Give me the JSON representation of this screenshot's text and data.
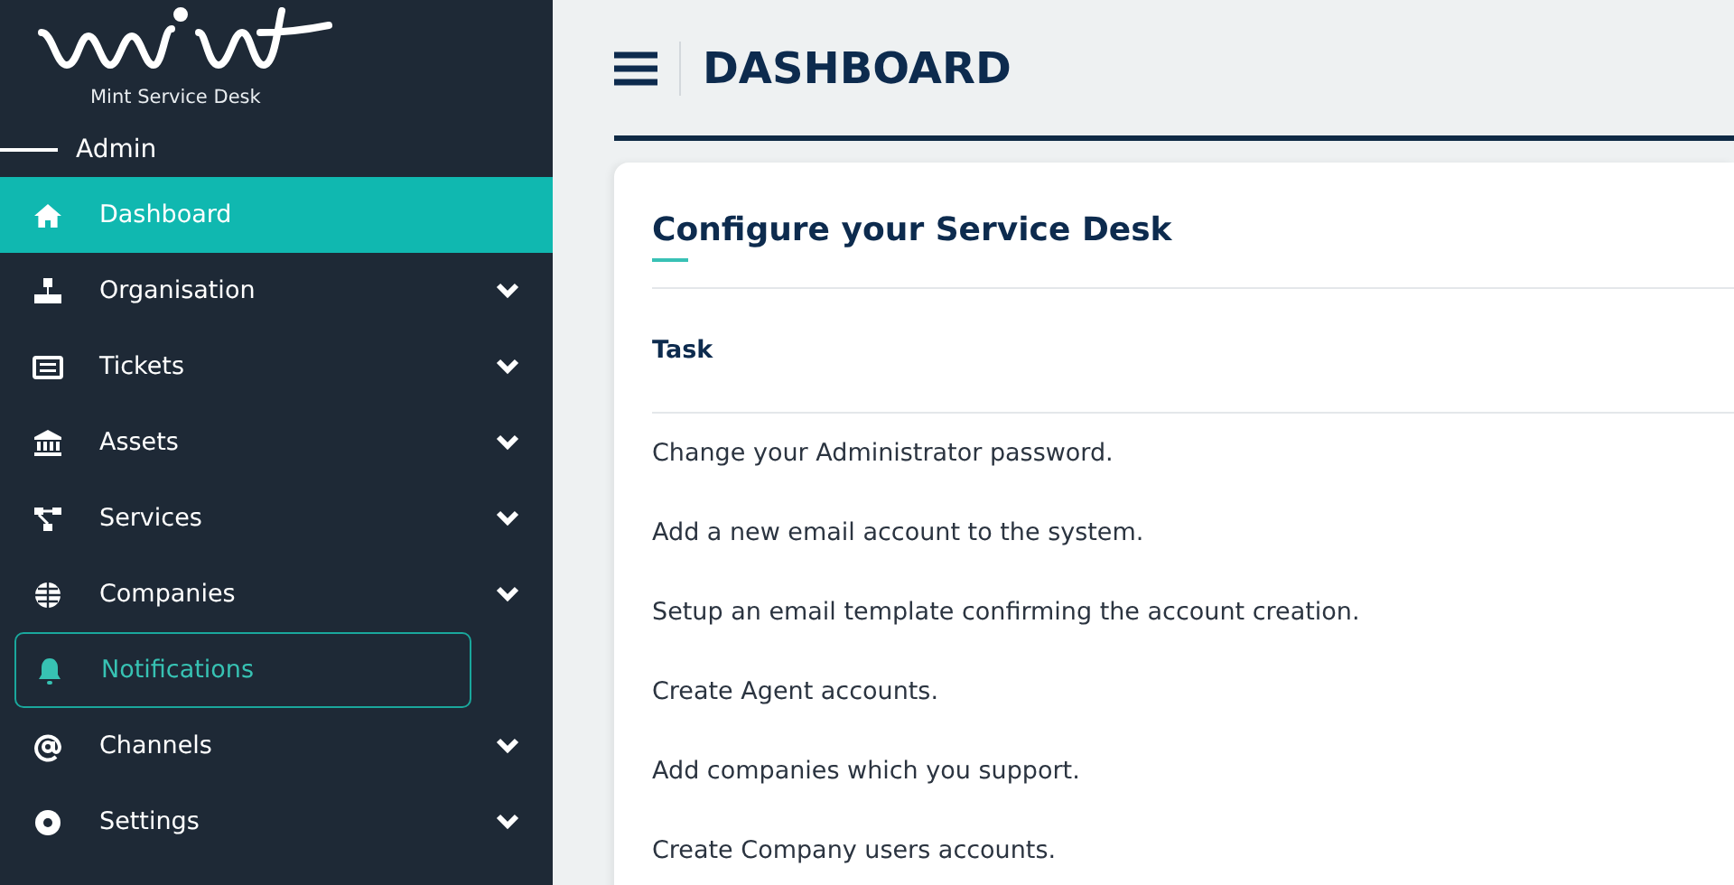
{
  "sidebar": {
    "brand": "Mint Service Desk",
    "section": "Admin",
    "items": [
      {
        "label": "Dashboard",
        "selected": true,
        "highlighted": false,
        "expandable": false
      },
      {
        "label": "Organisation",
        "selected": false,
        "highlighted": false,
        "expandable": true
      },
      {
        "label": "Tickets",
        "selected": false,
        "highlighted": false,
        "expandable": true
      },
      {
        "label": "Assets",
        "selected": false,
        "highlighted": false,
        "expandable": true
      },
      {
        "label": "Services",
        "selected": false,
        "highlighted": false,
        "expandable": true
      },
      {
        "label": "Companies",
        "selected": false,
        "highlighted": false,
        "expandable": true
      },
      {
        "label": "Notifications",
        "selected": false,
        "highlighted": true,
        "expandable": false
      },
      {
        "label": "Channels",
        "selected": false,
        "highlighted": false,
        "expandable": true
      },
      {
        "label": "Settings",
        "selected": false,
        "highlighted": false,
        "expandable": true
      }
    ]
  },
  "header": {
    "title": "DASHBOARD"
  },
  "card": {
    "title": "Configure your Service Desk",
    "column": "Task",
    "rows": [
      "Change your Administrator password.",
      "Add a new email account to the system.",
      "Setup an email template confirming the account creation.",
      "Create Agent accounts.",
      "Add companies which you support.",
      "Create Company users accounts."
    ]
  }
}
